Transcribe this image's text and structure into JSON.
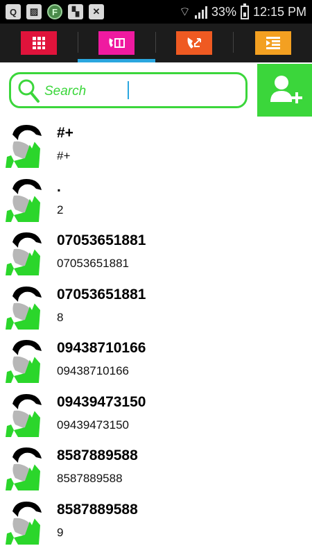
{
  "status_bar": {
    "left_icons": [
      "Q",
      "image-icon",
      "F",
      "flipboard-icon",
      "no-signal-icon"
    ],
    "battery": "33%",
    "time": "12:15 PM"
  },
  "tabs": [
    {
      "name": "grid",
      "icon": "grid-icon",
      "color": "#e0133b"
    },
    {
      "name": "contacts",
      "icon": "phone-book-icon",
      "color": "#ef1aa0",
      "active": true
    },
    {
      "name": "call-log",
      "icon": "call-arrows-icon",
      "color": "#ef5a22"
    },
    {
      "name": "menu",
      "icon": "list-icon",
      "color": "#f3a021"
    }
  ],
  "search": {
    "placeholder": "Search"
  },
  "contacts": [
    {
      "name": "#+",
      "number": "#+"
    },
    {
      "name": ".",
      "number": "2"
    },
    {
      "name": "07053651881",
      "number": "07053651881"
    },
    {
      "name": "07053651881",
      "number": "8"
    },
    {
      "name": "09438710166",
      "number": "09438710166"
    },
    {
      "name": "09439473150",
      "number": "09439473150"
    },
    {
      "name": "8587889588",
      "number": "8587889588"
    },
    {
      "name": "8587889588",
      "number": "9"
    }
  ],
  "accent": "#3bd63b"
}
